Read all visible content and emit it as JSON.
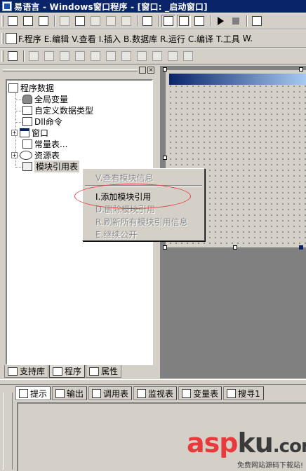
{
  "window": {
    "title": "易语言 - Windows窗口程序 - [窗口: _启动窗口]"
  },
  "menu": [
    {
      "id": "program",
      "label": "F.程序"
    },
    {
      "id": "edit",
      "label": "E.编辑"
    },
    {
      "id": "view",
      "label": "V.查看"
    },
    {
      "id": "insert",
      "label": "I.插入"
    },
    {
      "id": "database",
      "label": "B.数据库"
    },
    {
      "id": "run",
      "label": "R.运行"
    },
    {
      "id": "compile",
      "label": "C.编译"
    },
    {
      "id": "tools",
      "label": "T.工具"
    },
    {
      "id": "more",
      "label": "W."
    }
  ],
  "tree": {
    "root": "程序数据",
    "items": [
      {
        "id": "global-vars",
        "label": "全局变量"
      },
      {
        "id": "custom-types",
        "label": "自定义数据类型"
      },
      {
        "id": "dll-commands",
        "label": "Dll命令"
      },
      {
        "id": "windows",
        "label": "窗口"
      },
      {
        "id": "constants",
        "label": "常量表..."
      },
      {
        "id": "resources",
        "label": "资源表"
      },
      {
        "id": "module-refs",
        "label": "模块引用表"
      }
    ]
  },
  "context_menu": {
    "items": [
      {
        "id": "view-module-info",
        "label": "V.查看模块信息",
        "enabled": false
      },
      {
        "id": "add-module-ref",
        "label": "I.添加模块引用",
        "enabled": true
      },
      {
        "id": "delete-module-ref",
        "label": "D.删除模块引用",
        "enabled": false
      },
      {
        "id": "refresh-all",
        "label": "R.刷新所有模块引用信息",
        "enabled": false
      },
      {
        "id": "inherit-public",
        "label": "E.继续公开",
        "enabled": false
      }
    ]
  },
  "left_tabs": [
    {
      "id": "support-lib",
      "label": "支持库"
    },
    {
      "id": "program",
      "label": "程序"
    },
    {
      "id": "properties",
      "label": "属性"
    }
  ],
  "bottom_tabs": [
    {
      "id": "hint",
      "label": "提示"
    },
    {
      "id": "output",
      "label": "输出"
    },
    {
      "id": "call-stack",
      "label": "调用表"
    },
    {
      "id": "watch",
      "label": "监视表"
    },
    {
      "id": "variables",
      "label": "变量表"
    },
    {
      "id": "search",
      "label": "搜寻1"
    }
  ],
  "watermark": {
    "logo_a": "asp",
    "logo_b": "ku",
    "logo_c": ".com",
    "sub": "免费网站源码下载站!"
  },
  "colors": {
    "titlebar": "#0a246a",
    "highlight_ellipse": "#e04040",
    "watermark_red": "#e8393b"
  }
}
